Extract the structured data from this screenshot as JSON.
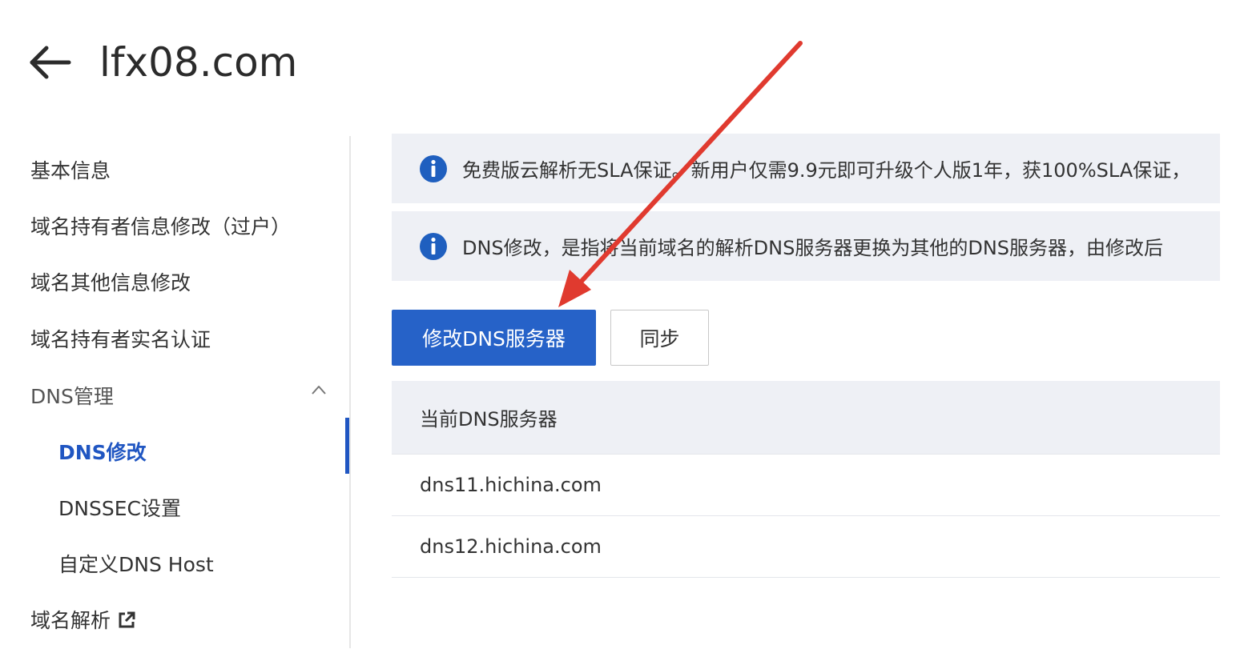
{
  "header": {
    "title": "lfx08.com",
    "back_icon": "arrow-left-icon"
  },
  "sidebar": {
    "items": [
      {
        "label": "基本信息"
      },
      {
        "label": "域名持有者信息修改（过户）"
      },
      {
        "label": "域名其他信息修改"
      },
      {
        "label": "域名持有者实名认证"
      },
      {
        "label": "DNS管理",
        "expanded": true
      },
      {
        "label": "DNS修改",
        "active": true
      },
      {
        "label": "DNSSEC设置"
      },
      {
        "label": "自定义DNS Host"
      },
      {
        "label": "域名解析",
        "icon": "external-link-icon"
      }
    ]
  },
  "main": {
    "notices": [
      {
        "icon": "info-icon",
        "text": "免费版云解析无SLA保证。新用户仅需9.9元即可升级个人版1年，获100%SLA保证，"
      },
      {
        "icon": "info-icon",
        "text": "DNS修改，是指将当前域名的解析DNS服务器更换为其他的DNS服务器，由修改后"
      }
    ],
    "buttons": {
      "modify_dns": "修改DNS服务器",
      "sync": "同步"
    },
    "table": {
      "header": "当前DNS服务器",
      "rows": [
        "dns11.hichina.com",
        "dns12.hichina.com"
      ]
    }
  },
  "colors": {
    "primary": "#2662c8",
    "active_nav": "#2056c2",
    "notice_bg": "#eef0f5",
    "annotation_arrow": "#e03a2f"
  }
}
